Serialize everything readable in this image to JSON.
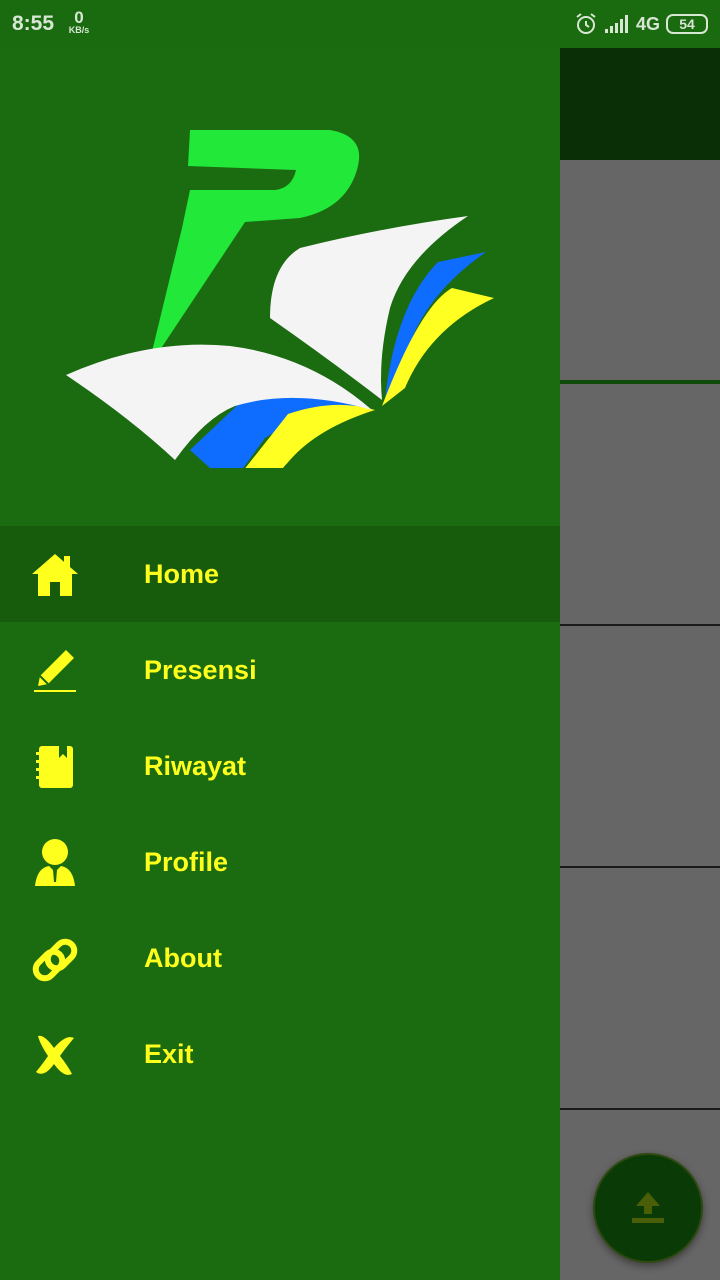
{
  "status_bar": {
    "time": "8:55",
    "net_speed_value": "0",
    "net_speed_unit": "KB/s",
    "network_type": "4G",
    "battery": "54",
    "icons": [
      "alarm-icon",
      "signal-icon",
      "battery-icon"
    ]
  },
  "drawer": {
    "logo": "app-logo-book",
    "menu": [
      {
        "label": "Home",
        "icon": "home-icon",
        "active": true
      },
      {
        "label": "Presensi",
        "icon": "pen-icon",
        "active": false
      },
      {
        "label": "Riwayat",
        "icon": "notebook-icon",
        "active": false
      },
      {
        "label": "Profile",
        "icon": "user-icon",
        "active": false
      },
      {
        "label": "About",
        "icon": "link-icon",
        "active": false
      },
      {
        "label": "Exit",
        "icon": "close-icon",
        "active": false
      }
    ]
  },
  "fab": {
    "icon": "upload-icon"
  },
  "colors": {
    "drawer_bg": "#1b6b11",
    "active_item_bg": "#175c0d",
    "menu_text": "#ffff1e",
    "scrim": "#666666",
    "toolbar": "#0a2e06"
  }
}
